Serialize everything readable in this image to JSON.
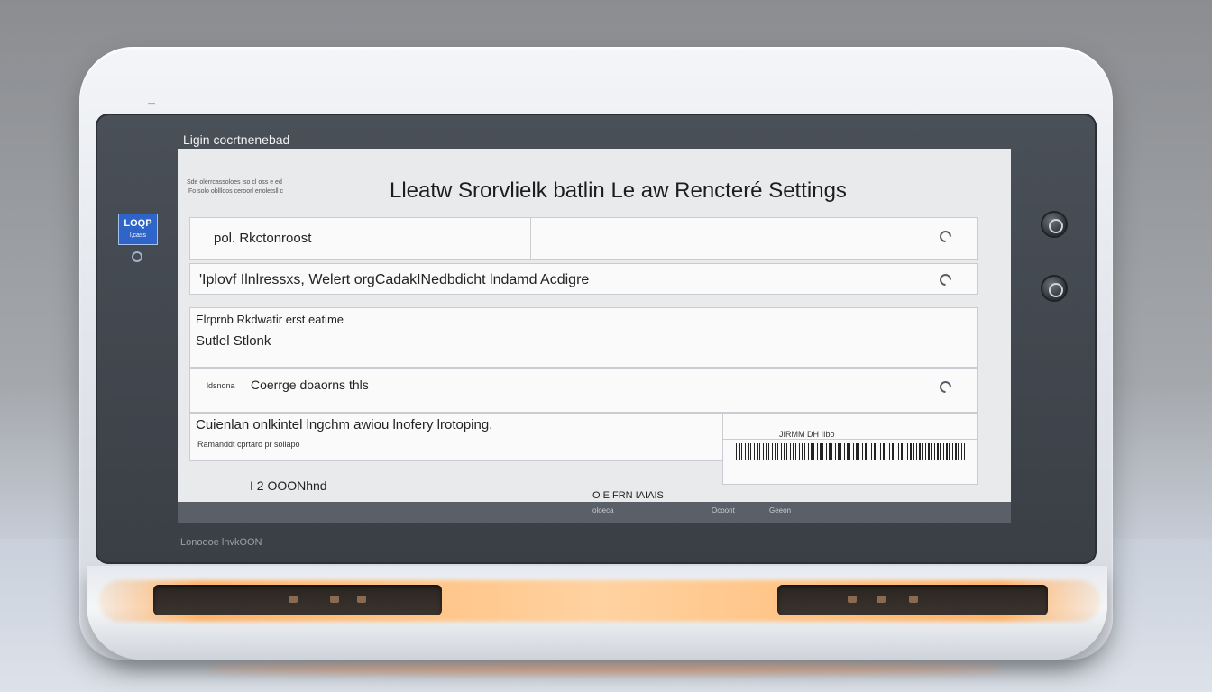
{
  "device": {
    "top_label": "—",
    "bottom_label": "Lonoooe lnvkOON",
    "badge_logo": "LOQP",
    "badge_sub": "l,cass"
  },
  "screen": {
    "caption": "Ligin cocrtnenebad",
    "title": "Lleatw Srorvlielk batlin Le aw Rencteré Settings",
    "header_mini_1": "Sde olerrcassoloes lso cl oss e ed",
    "header_mini_2": "Fo solo obllloos ceroorl enoletsll c",
    "rows": [
      {
        "label": "pol. Rkctonroost"
      },
      {
        "label": "'Iplovf Ilnlressxs, Welert orgCadakINedbdicht lndamd Acdigre"
      },
      {
        "label": "Elrprnb Rkdwatir erst eatime",
        "sub": "Sutlel Stlonk"
      },
      {
        "label": "Coerrge doaorns thls",
        "prefix": "ldsnona"
      },
      {
        "label": "Cuienlan onlkintel lngchm awiou lnofery lrotoping.",
        "sub": "Ramanddt cprtaro pr sollapo"
      }
    ],
    "barcode_label": "JIRMM DH IIbo",
    "value": "I 2 OOONhnd",
    "status": "O E FRN IAIAIS",
    "footer": [
      "oloeca",
      "Ocoont",
      "Geeon"
    ]
  },
  "icons": {
    "gear": "gear-icon",
    "radio": "radio-icon",
    "knob": "knob-icon"
  }
}
